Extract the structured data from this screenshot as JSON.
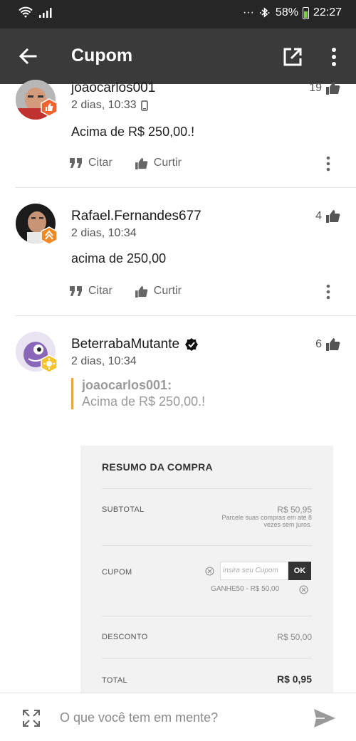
{
  "status_bar": {
    "battery_percent": "58%",
    "time": "22:27",
    "dots": "···"
  },
  "app_bar": {
    "title": "Cupom",
    "icons": [
      "back-arrow-icon",
      "open-external-icon",
      "more-vert-icon"
    ]
  },
  "posts": [
    {
      "username": "joaocarlos001",
      "time": "2 dias, 10:33",
      "likes": "19",
      "text": "Acima de R$ 250,00.!",
      "actions": {
        "quote": "Citar",
        "like": "Curtir"
      }
    },
    {
      "username": "Rafael.Fernandes677",
      "time": "2 dias, 10:34",
      "likes": "4",
      "text": "acima de 250,00",
      "actions": {
        "quote": "Citar",
        "like": "Curtir"
      }
    },
    {
      "username": "BeterrabaMutante",
      "time": "2 dias, 10:34",
      "likes": "6",
      "quote": {
        "user": "joaocarlos001:",
        "text": "Acima de R$ 250,00.!"
      }
    }
  ],
  "embedded_image": {
    "title": "RESUMO DA COMPRA",
    "subtotal_label": "SUBTOTAL",
    "subtotal_value": "R$ 50,95",
    "installment_note": "Parcele suas compras em até 8 vezes sem juros.",
    "coupon_label": "CUPOM",
    "coupon_placeholder": "insira seu Cupom",
    "ok_label": "OK",
    "coupon_applied": "GANHE50 - R$ 50,00",
    "discount_label": "DESCONTO",
    "discount_value": "R$ 50,00",
    "total_label": "TOTAL",
    "total_value": "R$ 0,95"
  },
  "composer": {
    "placeholder": "O que você tem em mente?"
  },
  "colors": {
    "status_bar": "#262626",
    "app_bar": "#3a3a3a",
    "quote_accent": "#f0a33a",
    "badge_orange": "#f08a24",
    "badge_yellow": "#f4c430"
  }
}
